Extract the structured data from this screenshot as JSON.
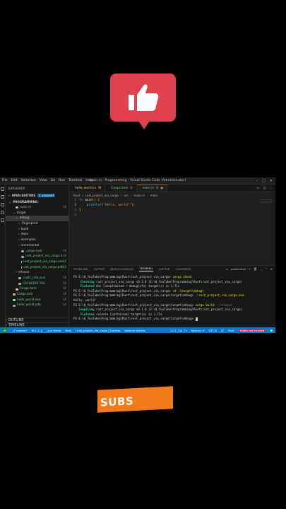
{
  "window": {
    "title": "main.rs - Programming - Visual Studio Code (Administrator)",
    "menu": [
      "File",
      "Edit",
      "Selection",
      "View",
      "Go",
      "Run",
      "Terminal",
      "Help"
    ]
  },
  "sidebar": {
    "header": "EXPLORER",
    "open_editors": {
      "label": "OPEN EDITORS",
      "badge": "1 unsaved"
    },
    "workspace": "PROGRAMMING",
    "items": [
      {
        "label": "main.rs",
        "mark": "U"
      },
      {
        "label": "target",
        "mark": ""
      },
      {
        "label": "debug",
        "mark": ""
      },
      {
        "label": ".fingerprint",
        "mark": ""
      },
      {
        "label": "build",
        "mark": ""
      },
      {
        "label": "deps",
        "mark": ""
      },
      {
        "label": "examples",
        "mark": ""
      },
      {
        "label": "incremental",
        "mark": ""
      },
      {
        "label": ".cargo-lock",
        "mark": "U"
      },
      {
        "label": "rust_project_via_cargo.d",
        "mark": "U"
      },
      {
        "label": "rust_project_via_cargo.exe",
        "mark": "U"
      },
      {
        "label": "rust_project_via_cargo.pdb",
        "mark": "U"
      },
      {
        "label": "release",
        "mark": ""
      },
      {
        "label": ".rustc_info.json",
        "mark": "U"
      },
      {
        "label": "CACHEDIR.TAG",
        "mark": "U"
      },
      {
        "label": "Cargo.toml",
        "mark": "U"
      },
      {
        "label": "Cargo.lock",
        "mark": "U"
      },
      {
        "label": "hello_world.exe",
        "mark": "U"
      },
      {
        "label": "hello_world.pdb",
        "mark": "U"
      }
    ],
    "outline": "OUTLINE",
    "timeline": "TIMELINE"
  },
  "tabs": [
    {
      "label": "hello_world.rs",
      "mark": "M"
    },
    {
      "label": "Cargo.toml",
      "mark": "U"
    },
    {
      "label": "main.rs",
      "mark": "U"
    }
  ],
  "breadcrumb": [
    "Rust",
    "rust_project_via_cargo",
    "src",
    "main.rs",
    "main"
  ],
  "editor": {
    "line_numbers": [
      "1",
      "2",
      "3",
      "4"
    ],
    "line1": {
      "kw": "fn",
      "fn": "main",
      "rest": "() {"
    },
    "line2": {
      "mac": "println!",
      "str": "\"Hello, world!\"",
      "rest": ");"
    },
    "line3": "}"
  },
  "panel": {
    "tabs": [
      "PROBLEMS",
      "OUTPUT",
      "DEBUG CONSOLE",
      "TERMINAL",
      "JUPYTER",
      "COMMENTS"
    ],
    "active_tab": "TERMINAL",
    "shell": "powershell",
    "terminal": {
      "l1_prompt": "PS E:\\0_YouTube\\Programming\\Rust\\rust_project_via_cargo> ",
      "l1_cmd": "cargo check",
      "l2_status": "Checking",
      "l2_rest": " rust_project_via_cargo v0.1.0 (E:\\0_YouTube\\Programming\\Rust\\rust_project_via_cargo)",
      "l3_status": "Finished",
      "l3_rest": " dev [unoptimized + debuginfo] target(s) in 1.71s",
      "l4_prompt": "PS E:\\0_YouTube\\Programming\\Rust\\rust_project_via_cargo> ",
      "l4_cmd": "cd .\\target\\debug\\",
      "l5_prompt": "PS E:\\0_YouTube\\Programming\\Rust\\rust_project_via_cargo\\target\\debug> ",
      "l5_cmd": ".\\rust_project_via_cargo.exe",
      "l6": "Hello, world!",
      "l7_prompt": "PS E:\\0_YouTube\\Programming\\Rust\\rust_project_via_cargo\\target\\debug> ",
      "l7_cmd": "cargo build",
      "l7_flag": " --release",
      "l8_status": "Compiling",
      "l8_rest": " rust_project_via_cargo v0.1.0 (E:\\0_YouTube\\Programming\\Rust\\rust_project_via_cargo)",
      "l9_status": "Finished",
      "l9_rest": " release [optimized] target(s) in 3.73s",
      "l10_prompt": "PS E:\\0_YouTube\\Programming\\Rust\\rust_project_via_cargo\\target\\debug> "
    }
  },
  "statusbar": {
    "branch": "master*",
    "errors": "0",
    "warnings": "0",
    "live_share": "Live Share",
    "rust_status": "Rust",
    "starting": "[rust_project_via_cargo] Starting",
    "tabnine": "tabnine starter",
    "position": "Ln 2, Col 13",
    "spaces": "Spaces: 4",
    "encoding": "UTF-8",
    "eol": "LF",
    "language": "Rust",
    "notice": "Editor not trusted"
  },
  "overlay": {
    "subs_text": "SUBS",
    "colors": {
      "like_red": "#e0414f",
      "subs_orange": "#f27a1a",
      "status_blue": "#0078d4"
    }
  }
}
